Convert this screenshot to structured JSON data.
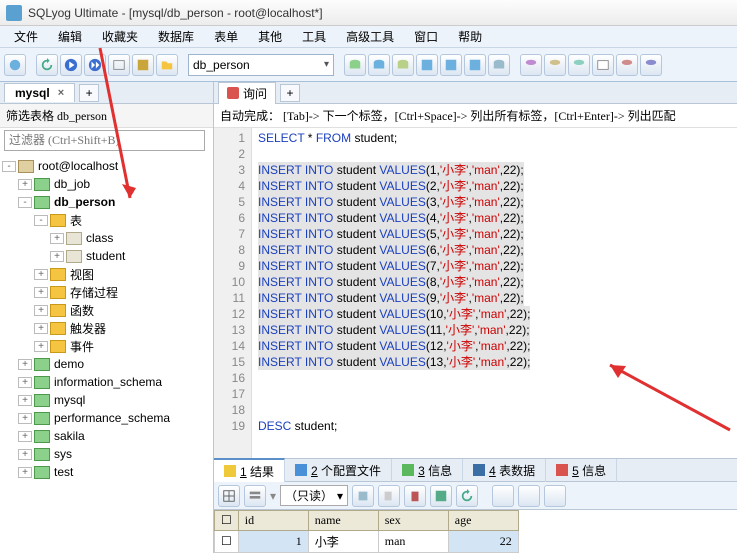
{
  "title": "SQLyog Ultimate - [mysql/db_person - root@localhost*]",
  "menus": [
    "文件",
    "编辑",
    "收藏夹",
    "数据库",
    "表单",
    "其他",
    "工具",
    "高级工具",
    "窗口",
    "帮助"
  ],
  "db_selected": "db_person",
  "conn_tab": "mysql",
  "newtab": "+",
  "filter_label": "筛选表格 db_person",
  "filter_placeholder": "过滤器 (Ctrl+Shift+B)",
  "tree": {
    "root": "root@localhost",
    "dbs": [
      "db_job",
      "db_person",
      "demo",
      "information_schema",
      "mysql",
      "performance_schema",
      "sakila",
      "sys",
      "test"
    ],
    "person_children": [
      "表",
      "视图",
      "存储过程",
      "函数",
      "触发器",
      "事件"
    ],
    "tables": [
      "class",
      "student"
    ]
  },
  "query_tab": "询问",
  "hint": "自动完成：  [Tab]-> 下一个标签，[Ctrl+Space]-> 列出所有标签，[Ctrl+Enter]-> 列出匹配",
  "sql": {
    "select": "SELECT * FROM student;",
    "desc": "DESC student;",
    "inserts": [
      {
        "n": 1,
        "name": "'小李'",
        "sex": "'man'",
        "age": 22
      },
      {
        "n": 2,
        "name": "'小李'",
        "sex": "'man'",
        "age": 22
      },
      {
        "n": 3,
        "name": "'小李'",
        "sex": "'man'",
        "age": 22
      },
      {
        "n": 4,
        "name": "'小李'",
        "sex": "'man'",
        "age": 22
      },
      {
        "n": 5,
        "name": "'小李'",
        "sex": "'man'",
        "age": 22
      },
      {
        "n": 6,
        "name": "'小李'",
        "sex": "'man'",
        "age": 22
      },
      {
        "n": 7,
        "name": "'小李'",
        "sex": "'man'",
        "age": 22
      },
      {
        "n": 8,
        "name": "'小李'",
        "sex": "'man'",
        "age": 22
      },
      {
        "n": 9,
        "name": "'小李'",
        "sex": "'man'",
        "age": 22
      },
      {
        "n": 10,
        "name": "'小李'",
        "sex": "'man'",
        "age": 22
      },
      {
        "n": 11,
        "name": "'小李'",
        "sex": "'man'",
        "age": 22
      },
      {
        "n": 12,
        "name": "'小李'",
        "sex": "'man'",
        "age": 22
      },
      {
        "n": 13,
        "name": "'小李'",
        "sex": "'man'",
        "age": 22
      }
    ]
  },
  "result_tabs": [
    {
      "icon": "#f0c93a",
      "label": "1 结果",
      "u": "1"
    },
    {
      "icon": "#4a90d9",
      "label": "2 个配置文件",
      "u": "2"
    },
    {
      "icon": "#5cb85c",
      "label": "3 信息",
      "u": "3"
    },
    {
      "icon": "#3a6ea5",
      "label": "4 表数据",
      "u": "4"
    },
    {
      "icon": "#d9534f",
      "label": "5 信息",
      "u": "5"
    }
  ],
  "readonly": "（只读）",
  "grid": {
    "cols": [
      "id",
      "name",
      "sex",
      "age"
    ],
    "row": {
      "id": "1",
      "name": "小李",
      "sex": "man",
      "age": "22"
    }
  }
}
